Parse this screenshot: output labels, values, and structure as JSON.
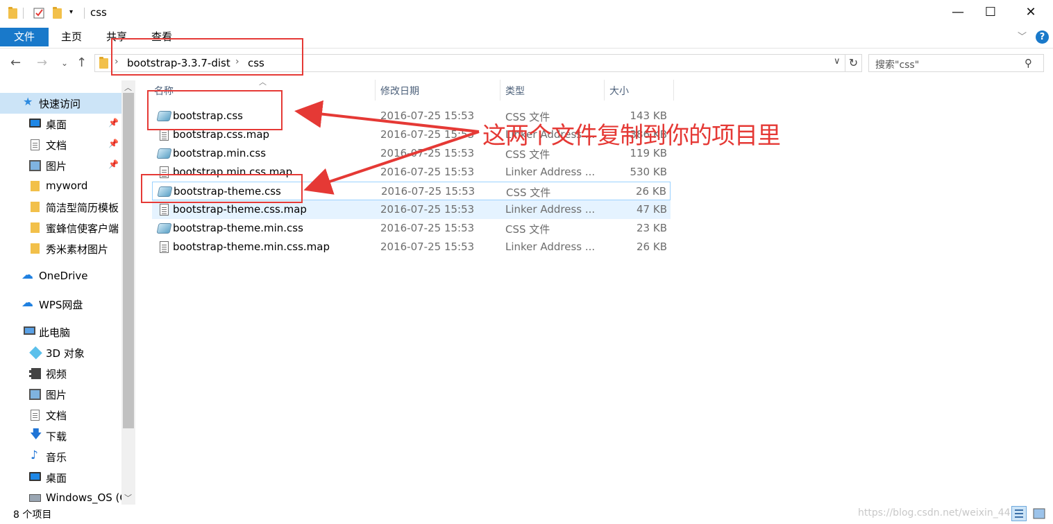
{
  "window": {
    "title": "css",
    "controls": {
      "minimize": "—",
      "maximize": "☐",
      "close": "✕"
    }
  },
  "ribbon": {
    "tabs": [
      "文件",
      "主页",
      "共享",
      "查看"
    ],
    "help": "?"
  },
  "address": {
    "crumbs": [
      "bootstrap-3.3.7-dist",
      "css"
    ],
    "search_placeholder": "搜索\"css\""
  },
  "sidebar": {
    "items": [
      {
        "label": "快速访问",
        "icon": "star-icon",
        "pinned": false,
        "selected": true
      },
      {
        "label": "桌面",
        "icon": "desktop-icon",
        "pinned": true
      },
      {
        "label": "文档",
        "icon": "document-icon",
        "pinned": true
      },
      {
        "label": "图片",
        "icon": "picture-icon",
        "pinned": true
      },
      {
        "label": "myword",
        "icon": "folder-icon",
        "pinned": false
      },
      {
        "label": "简洁型简历模板",
        "icon": "folder-icon",
        "pinned": false
      },
      {
        "label": "蜜蜂信使客户端",
        "icon": "folder-icon",
        "pinned": false
      },
      {
        "label": "秀米素材图片",
        "icon": "folder-icon",
        "pinned": false
      },
      {
        "label": "OneDrive",
        "icon": "onedrive-cloud-icon",
        "pinned": false
      },
      {
        "label": "WPS网盘",
        "icon": "wps-cloud-icon",
        "pinned": false
      },
      {
        "label": "此电脑",
        "icon": "this-pc-icon",
        "pinned": false
      },
      {
        "label": "3D 对象",
        "icon": "3d-objects-icon",
        "pinned": false
      },
      {
        "label": "视频",
        "icon": "video-icon",
        "pinned": false
      },
      {
        "label": "图片",
        "icon": "picture-icon",
        "pinned": false
      },
      {
        "label": "文档",
        "icon": "document-icon",
        "pinned": false
      },
      {
        "label": "下载",
        "icon": "download-icon",
        "pinned": false
      },
      {
        "label": "音乐",
        "icon": "music-icon",
        "pinned": false
      },
      {
        "label": "桌面",
        "icon": "desktop-icon",
        "pinned": false
      },
      {
        "label": "Windows_OS (C",
        "icon": "drive-icon",
        "pinned": false
      }
    ]
  },
  "columns": {
    "name": "名称",
    "date": "修改日期",
    "type": "类型",
    "size": "大小"
  },
  "files": [
    {
      "name": "bootstrap.css",
      "date": "2016-07-25 15:53",
      "type": "CSS 文件",
      "size": "143 KB",
      "icon": "css-file-icon"
    },
    {
      "name": "bootstrap.css.map",
      "date": "2016-07-25 15:53",
      "type": "Linker Address ...",
      "size": "386 KB",
      "icon": "map-file-icon"
    },
    {
      "name": "bootstrap.min.css",
      "date": "2016-07-25 15:53",
      "type": "CSS 文件",
      "size": "119 KB",
      "icon": "css-file-icon"
    },
    {
      "name": "bootstrap.min.css.map",
      "date": "2016-07-25 15:53",
      "type": "Linker Address ...",
      "size": "530 KB",
      "icon": "map-file-icon"
    },
    {
      "name": "bootstrap-theme.css",
      "date": "2016-07-25 15:53",
      "type": "CSS 文件",
      "size": "26 KB",
      "icon": "css-file-icon"
    },
    {
      "name": "bootstrap-theme.css.map",
      "date": "2016-07-25 15:53",
      "type": "Linker Address ...",
      "size": "47 KB",
      "icon": "map-file-icon"
    },
    {
      "name": "bootstrap-theme.min.css",
      "date": "2016-07-25 15:53",
      "type": "CSS 文件",
      "size": "23 KB",
      "icon": "css-file-icon"
    },
    {
      "name": "bootstrap-theme.min.css.map",
      "date": "2016-07-25 15:53",
      "type": "Linker Address ...",
      "size": "26 KB",
      "icon": "map-file-icon"
    }
  ],
  "status": {
    "item_count": "8 个项目"
  },
  "watermark": "https://blog.csdn.net/weixin_44",
  "annotation": {
    "text": "这两个文件复制到你的项目里",
    "color": "#e53935"
  },
  "colors": {
    "accent": "#1979ca",
    "selection": "#cce4f7",
    "hover": "#e5f3ff"
  }
}
